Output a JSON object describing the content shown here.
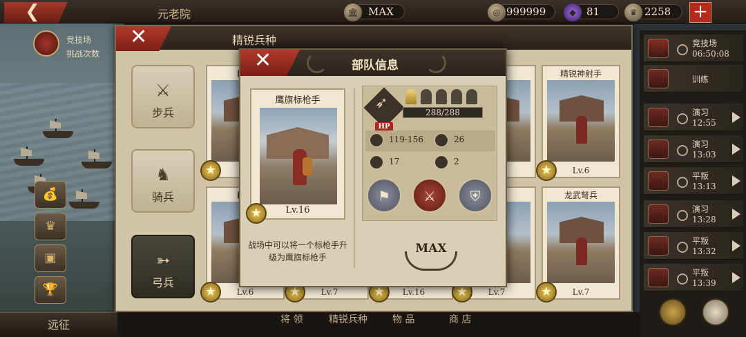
{
  "topbar": {
    "back_glyph": "❮",
    "title": "元老院",
    "building_level": "MAX",
    "coins": "999999",
    "gems": "81",
    "laurels": "2258",
    "plus_glyph": "+"
  },
  "left": {
    "arena_line1": "竞技场",
    "arena_line2": "挑战次数",
    "expedition": "远征"
  },
  "right_panel": {
    "items": [
      {
        "name": "竞技场",
        "time": "06:50:08"
      },
      {
        "name": "训练",
        "time": ""
      },
      {
        "name": "演习",
        "time": "12:55"
      },
      {
        "name": "演习",
        "time": "13:03"
      },
      {
        "name": "平叛",
        "time": "13:13"
      },
      {
        "name": "演习",
        "time": "13:28"
      },
      {
        "name": "平叛",
        "time": "13:32"
      },
      {
        "name": "平叛",
        "time": "13:39"
      }
    ]
  },
  "elite": {
    "title": "精锐兵种",
    "close_glyph": "✕",
    "categories": [
      {
        "label": "步兵",
        "icon": "infantry-icon",
        "glyph": "⚔"
      },
      {
        "label": "骑兵",
        "icon": "cavalry-icon",
        "glyph": "♞"
      },
      {
        "label": "弓兵",
        "icon": "archer-icon",
        "glyph": "➳"
      }
    ],
    "cards": [
      {
        "name": "精锐",
        "lv": ""
      },
      {
        "name": "",
        "lv": ""
      },
      {
        "name": "",
        "lv": ""
      },
      {
        "name": "射手",
        "lv": ""
      },
      {
        "name": "精锐神射手",
        "lv": "Lv.6"
      },
      {
        "name": "精锐",
        "lv": "Lv.6"
      },
      {
        "name": "",
        "lv": "Lv.7"
      },
      {
        "name": "",
        "lv": "Lv.16"
      },
      {
        "name": "兵",
        "lv": "Lv.7"
      },
      {
        "name": "龙武弩兵",
        "lv": "Lv.7"
      }
    ],
    "star_glyph": "★"
  },
  "bottom_tabs": [
    "将 领",
    "精锐兵种",
    "物 品",
    "商 店"
  ],
  "info": {
    "title": "部队信息",
    "close_glyph": "✕",
    "unit_name": "鹰旗标枪手",
    "unit_level": "Lv.16",
    "description": "战场中可以将一个标枪手升级为鹰旗标枪手",
    "hp_tag": "HP",
    "hp": "288/288",
    "attack": "119-156",
    "defense": "26",
    "speed": "17",
    "vision": "2",
    "max_label": "MAX",
    "ranks_total": 5,
    "ranks_filled": 1
  }
}
